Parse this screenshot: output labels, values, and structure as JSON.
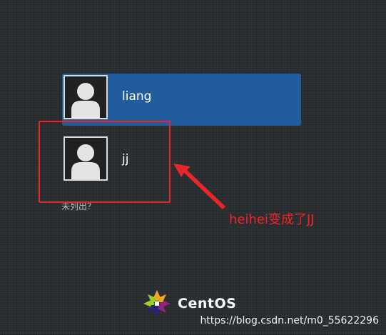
{
  "users": [
    {
      "name": "liang",
      "selected": true
    },
    {
      "name": "jj",
      "selected": false
    }
  ],
  "not_listed_label": "未列出？",
  "annotation": {
    "text": "heihei变成了JJ",
    "color": "#e8262a"
  },
  "brand": {
    "name": "CentOS"
  },
  "watermark": "https://blog.csdn.net/m0_55622296",
  "colors": {
    "selected_row": "#215d9c",
    "background": "#2b2e31"
  }
}
